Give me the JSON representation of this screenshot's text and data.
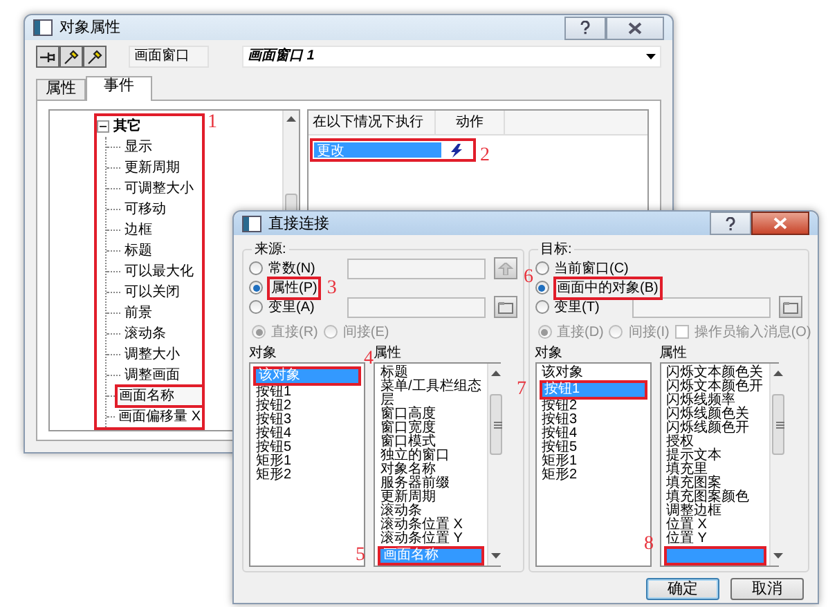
{
  "properties_window": {
    "title": "对象属性",
    "object_type": "画面窗口",
    "object_name": "画面窗口 1",
    "tabs": [
      {
        "label": "属性",
        "selected": false
      },
      {
        "label": "事件",
        "selected": true
      }
    ],
    "tree": {
      "label": "其它",
      "expanded": true,
      "annotation": "1",
      "children": [
        {
          "label": "显示",
          "marked": false
        },
        {
          "label": "更新周期",
          "marked": false
        },
        {
          "label": "可调整大小",
          "marked": false
        },
        {
          "label": "可移动",
          "marked": false
        },
        {
          "label": "边框",
          "marked": false
        },
        {
          "label": "标题",
          "marked": false
        },
        {
          "label": "可以最大化",
          "marked": false
        },
        {
          "label": "可以关闭",
          "marked": false
        },
        {
          "label": "前景",
          "marked": false
        },
        {
          "label": "滚动条",
          "marked": false
        },
        {
          "label": "调整大小",
          "marked": false
        },
        {
          "label": "调整画面",
          "marked": false
        },
        {
          "label": "画面名称",
          "marked": true
        },
        {
          "label": "画面偏移量 X",
          "marked": false
        }
      ]
    },
    "events": {
      "columns": [
        "在以下情况下执行",
        "动作"
      ],
      "rows": [
        {
          "condition": "更改",
          "selected": true,
          "annotation": "2"
        }
      ]
    }
  },
  "connection_dialog": {
    "title": "直接连接",
    "source": {
      "label": "来源:",
      "options": [
        {
          "label": "常数(N)",
          "selected": false,
          "kind": "field"
        },
        {
          "label": "属性(P)",
          "selected": true,
          "kind": "plain",
          "annotation": "3"
        },
        {
          "label": "变里(A)",
          "selected": false,
          "kind": "field"
        }
      ],
      "mode": [
        {
          "label": "直接(R)",
          "selected": true
        },
        {
          "label": "间接(E)",
          "selected": false
        }
      ],
      "objects_label": "对象",
      "objects": [
        {
          "label": "该对象",
          "selected": true,
          "annotation": "4"
        },
        {
          "label": "按钮1",
          "selected": false
        },
        {
          "label": "按钮2",
          "selected": false
        },
        {
          "label": "按钮3",
          "selected": false
        },
        {
          "label": "按钮4",
          "selected": false
        },
        {
          "label": "按钮5",
          "selected": false
        },
        {
          "label": "矩形1",
          "selected": false
        },
        {
          "label": "矩形2",
          "selected": false
        }
      ],
      "properties_label": "属性",
      "properties": [
        {
          "label": "标题",
          "selected": false
        },
        {
          "label": "菜单/工具栏组态",
          "selected": false
        },
        {
          "label": "层",
          "selected": false
        },
        {
          "label": "窗口高度",
          "selected": false
        },
        {
          "label": "窗口宽度",
          "selected": false
        },
        {
          "label": "窗口模式",
          "selected": false
        },
        {
          "label": "独立的窗口",
          "selected": false
        },
        {
          "label": "对象名称",
          "selected": false
        },
        {
          "label": "服务器前缀",
          "selected": false
        },
        {
          "label": "更新周期",
          "selected": false
        },
        {
          "label": "滚动条",
          "selected": false
        },
        {
          "label": "滚动条位置 X",
          "selected": false
        },
        {
          "label": "滚动条位置 Y",
          "selected": false
        },
        {
          "label": "画面名称",
          "selected": true,
          "annotation": "5"
        }
      ]
    },
    "target": {
      "label": "目标:",
      "options": [
        {
          "label": "当前窗口(C)",
          "selected": false,
          "kind": "plain"
        },
        {
          "label": "画面中的对象(B)",
          "selected": true,
          "kind": "plain",
          "annotation": "6"
        },
        {
          "label": "变里(T)",
          "selected": false,
          "kind": "field"
        }
      ],
      "mode": [
        {
          "label": "直接(D)",
          "selected": true
        },
        {
          "label": "间接(I)",
          "selected": false
        }
      ],
      "operator_message": {
        "label": "操作员输入消息(O)",
        "checked": false
      },
      "objects_label": "对象",
      "objects": [
        {
          "label": "该对象",
          "selected": false
        },
        {
          "label": "按钮1",
          "selected": true,
          "annotation": "7"
        },
        {
          "label": "按钮2",
          "selected": false
        },
        {
          "label": "按钮3",
          "selected": false
        },
        {
          "label": "按钮4",
          "selected": false
        },
        {
          "label": "按钮5",
          "selected": false
        },
        {
          "label": "矩形1",
          "selected": false
        },
        {
          "label": "矩形2",
          "selected": false
        }
      ],
      "properties_label": "属性",
      "properties": [
        {
          "label": "闪烁文本颜色关",
          "selected": false
        },
        {
          "label": "闪烁文本颜色开",
          "selected": false
        },
        {
          "label": "闪烁线频率",
          "selected": false
        },
        {
          "label": "闪烁线颜色关",
          "selected": false
        },
        {
          "label": "闪烁线颜色开",
          "selected": false
        },
        {
          "label": "授权",
          "selected": false
        },
        {
          "label": "提示文本",
          "selected": false
        },
        {
          "label": "填充里",
          "selected": false
        },
        {
          "label": "填充图案",
          "selected": false
        },
        {
          "label": "填充图案颜色",
          "selected": false
        },
        {
          "label": "调整边框",
          "selected": false
        },
        {
          "label": "位置 X",
          "selected": false
        },
        {
          "label": "位置 Y",
          "selected": false
        }
      ],
      "obscured_row": {
        "selected": true,
        "annotation": "8"
      }
    },
    "buttons": [
      {
        "label": "确定",
        "default": true
      },
      {
        "label": "取消",
        "default": false
      }
    ]
  }
}
